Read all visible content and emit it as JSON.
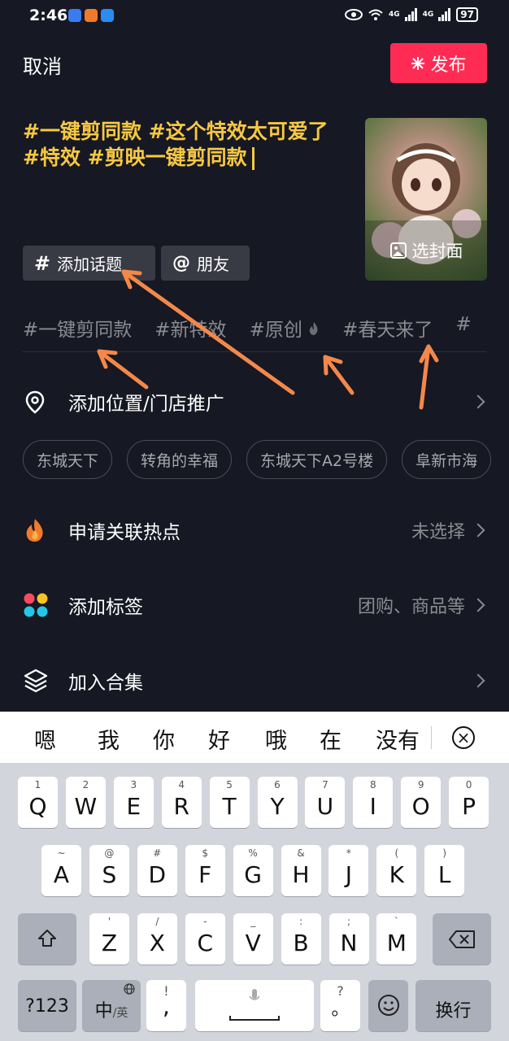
{
  "status": {
    "time": "2:46",
    "battery": "97",
    "net1": "4G",
    "net2": "4G"
  },
  "header": {
    "cancel": "取消",
    "publish": "发布"
  },
  "caption": {
    "line1": "#一键剪同款 #这个特效太可爱了",
    "line2": "#特效 #剪映一键剪同款"
  },
  "cover": {
    "label": "选封面"
  },
  "chips": {
    "topic": "添加话题",
    "friend": "朋友",
    "topic_glyph": "#",
    "friend_glyph": "@"
  },
  "topics": [
    "#一键剪同款",
    "#新特效",
    "#原创",
    "#春天来了",
    "#"
  ],
  "location": {
    "label": "添加位置/门店推广"
  },
  "location_chips": [
    "东城天下",
    "转角的幸福",
    "东城天下A2号楼",
    "阜新市海"
  ],
  "hotspot": {
    "label": "申请关联热点",
    "value": "未选择"
  },
  "tags": {
    "label": "添加标签",
    "value": "团购、商品等"
  },
  "collection": {
    "label": "加入合集"
  },
  "candidates": [
    "嗯",
    "我",
    "你",
    "好",
    "哦",
    "在",
    "没有"
  ],
  "keyboard": {
    "row1": [
      [
        "1",
        "Q"
      ],
      [
        "2",
        "W"
      ],
      [
        "3",
        "E"
      ],
      [
        "4",
        "R"
      ],
      [
        "5",
        "T"
      ],
      [
        "6",
        "Y"
      ],
      [
        "7",
        "U"
      ],
      [
        "8",
        "I"
      ],
      [
        "9",
        "O"
      ],
      [
        "0",
        "P"
      ]
    ],
    "row2": [
      [
        "~",
        "A"
      ],
      [
        "@",
        "S"
      ],
      [
        "#",
        "D"
      ],
      [
        "$",
        "F"
      ],
      [
        "%",
        "G"
      ],
      [
        "&",
        "H"
      ],
      [
        "*",
        "J"
      ],
      [
        "(",
        "K"
      ],
      [
        ")",
        "L"
      ]
    ],
    "row3": [
      [
        "'",
        "Z"
      ],
      [
        "/",
        "X"
      ],
      [
        "-",
        "C"
      ],
      [
        "_",
        "V"
      ],
      [
        ":",
        "B"
      ],
      [
        ";",
        "N"
      ],
      [
        "`",
        "M"
      ]
    ],
    "sym": "?123",
    "lang_main": "中",
    "lang_sub": "/英",
    "punct_top": "!",
    "punct_bottom": ",",
    "punct2_top": "?",
    "punct2_bottom": "。",
    "enter": "换行"
  },
  "colors": {
    "accent": "#fe2c55",
    "caption": "#f7c843",
    "bg": "#161823",
    "arrow": "#f4884a"
  }
}
